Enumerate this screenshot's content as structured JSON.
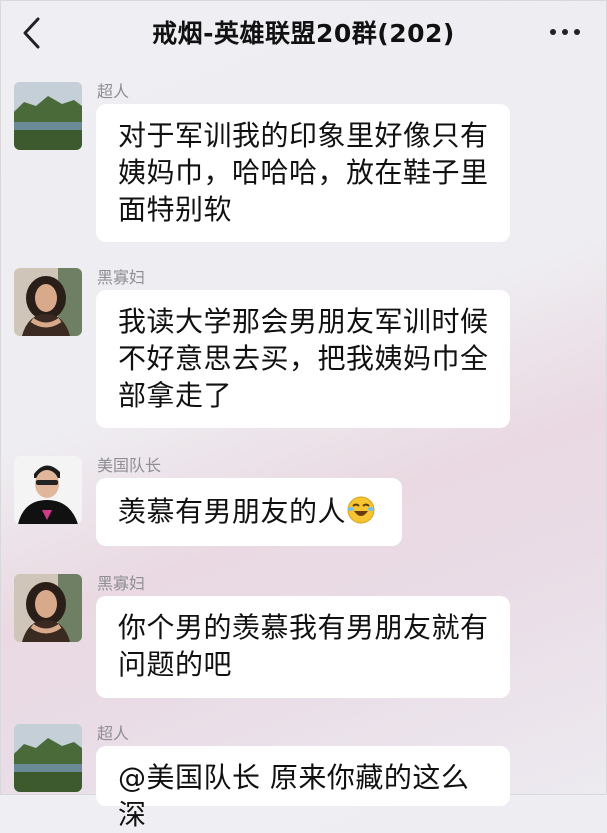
{
  "header": {
    "title": "戒烟-英雄联盟20群(202)",
    "back_icon": "chevron-left-icon",
    "more_icon": "more-dots-icon"
  },
  "messages": [
    {
      "sender": "超人",
      "text": "对于军训我的印象里好像只有姨妈巾，哈哈哈，放在鞋子里面特别软",
      "avatar": "landscape-avatar"
    },
    {
      "sender": "黑寡妇",
      "text": "我读大学那会男朋友军训时候不好意思去买，把我姨妈巾全部拿走了",
      "avatar": "woman-avatar"
    },
    {
      "sender": "美国队长",
      "text": "羡慕有男朋友的人",
      "emoji": "laughing-crying-emoji",
      "avatar": "man-avatar"
    },
    {
      "sender": "黑寡妇",
      "text": "你个男的羡慕我有男朋友就有问题的吧",
      "avatar": "woman-avatar"
    },
    {
      "sender": "超人",
      "text": "@美国队长 原来你藏的这么深",
      "avatar": "landscape-avatar"
    }
  ]
}
